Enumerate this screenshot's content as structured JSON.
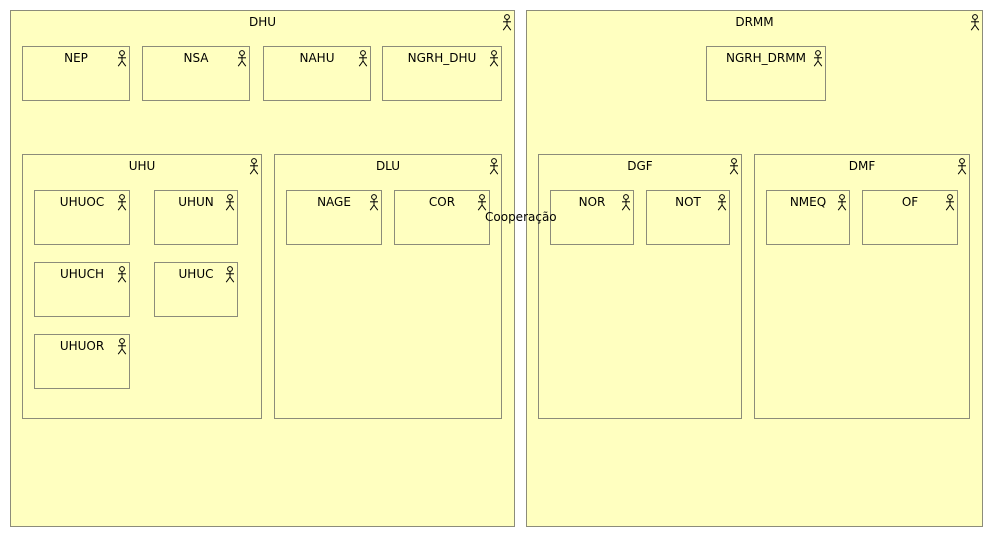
{
  "icon": "actor-icon",
  "colors": {
    "fill": "#ffffc0",
    "border": "#8c8c7a"
  },
  "dhu": {
    "name": "DHU",
    "nep": "NEP",
    "nsa": "NSA",
    "nahu": "NAHU",
    "ngrh_dhu": "NGRH_DHU",
    "uhu": {
      "name": "UHU",
      "uhuoc": "UHUOC",
      "uhun": "UHUN",
      "uhuch": "UHUCH",
      "uhuc": "UHUC",
      "uhuor": "UHUOR"
    },
    "dlu": {
      "name": "DLU",
      "nage": "NAGE",
      "cor": "COR"
    }
  },
  "drmm": {
    "name": "DRMM",
    "ngrh_drmm": "NGRH_DRMM",
    "dgf": {
      "name": "DGF",
      "nor": "NOR",
      "not": "NOT"
    },
    "dmf": {
      "name": "DMF",
      "nmeq": "NMEQ",
      "of": "OF"
    }
  },
  "relation_label": "Cooperação"
}
